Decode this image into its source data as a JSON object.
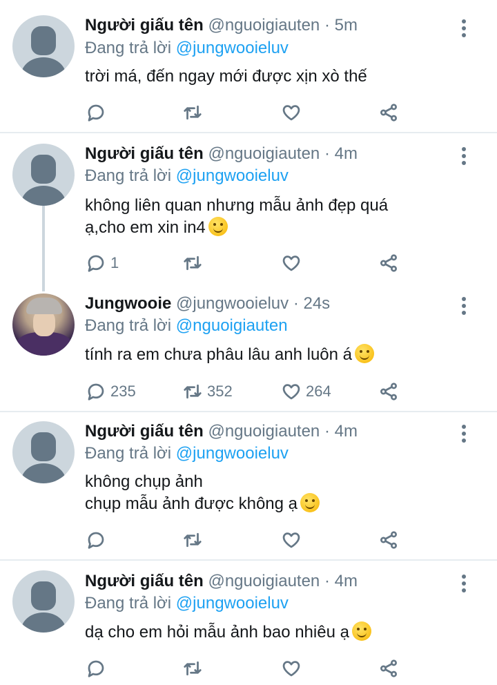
{
  "tweets": [
    {
      "name": "Người giấu tên",
      "handle": "@nguoigiauten",
      "separator": "·",
      "time": "5m",
      "reply_prefix": "Đang trả lời",
      "reply_to": "@jungwooieluv",
      "text_lines": [
        "trời má, đến ngay mới được xịn xò thế"
      ],
      "avatar": "default-avatar",
      "counts": {
        "reply": "",
        "retweet": "",
        "like": ""
      }
    },
    {
      "name": "Người giấu tên",
      "handle": "@nguoigiauten",
      "separator": "·",
      "time": "4m",
      "reply_prefix": "Đang trả lời",
      "reply_to": "@jungwooieluv",
      "text_lines": [
        "không liên quan nhưng mẫu ảnh đẹp quá",
        "ạ,cho em xin in4"
      ],
      "emoji": "savoring-face-emoji",
      "avatar": "default-avatar",
      "counts": {
        "reply": "1",
        "retweet": "",
        "like": ""
      }
    },
    {
      "name": "Jungwooie",
      "handle": "@jungwooieluv",
      "separator": "·",
      "time": "24s",
      "reply_prefix": "Đang trả lời",
      "reply_to": "@nguoigiauten",
      "text_lines": [
        "tính ra em chưa phâu lâu anh luôn á"
      ],
      "emoji": "raised-eyebrow-emoji",
      "avatar": "photo-avatar",
      "counts": {
        "reply": "235",
        "retweet": "352",
        "like": "264"
      }
    },
    {
      "name": "Người giấu tên",
      "handle": "@nguoigiauten",
      "separator": "·",
      "time": "4m",
      "reply_prefix": "Đang trả lời",
      "reply_to": "@jungwooieluv",
      "text_lines": [
        "không chụp ảnh",
        "chụp mẫu ảnh được không ạ"
      ],
      "emoji": "grinning-face-emoji",
      "avatar": "default-avatar",
      "counts": {
        "reply": "",
        "retweet": "",
        "like": ""
      }
    },
    {
      "name": "Người giấu tên",
      "handle": "@nguoigiauten",
      "separator": "·",
      "time": "4m",
      "reply_prefix": "Đang trả lời",
      "reply_to": "@jungwooieluv",
      "text_lines": [
        "dạ cho em hỏi mẫu ảnh bao nhiêu ạ"
      ],
      "emoji": "smiling-face-emoji",
      "avatar": "default-avatar",
      "counts": {
        "reply": "",
        "retweet": "",
        "like": ""
      }
    }
  ],
  "colors": {
    "accent": "#1da1f2",
    "muted": "#657786",
    "text": "#14171a",
    "divider": "#e6ecf0"
  }
}
